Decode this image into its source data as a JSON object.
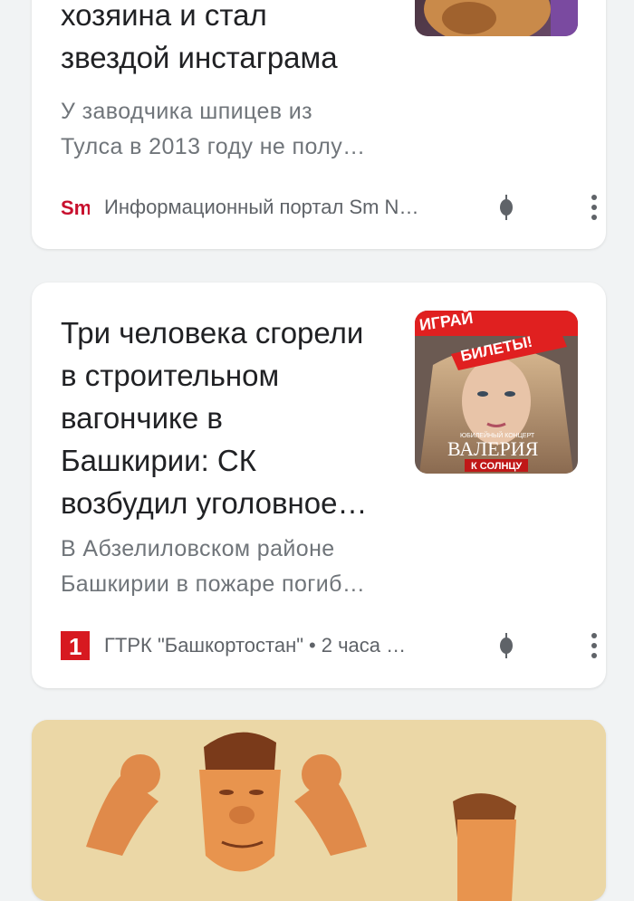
{
  "cards": [
    {
      "title_lines": [
        "хозяина и стал",
        "звездой инстаграма"
      ],
      "snippet_lines": [
        "У заводчика шпицев из",
        "Тулса в 2013 году не полу…"
      ],
      "source": {
        "logo_text": "Sm",
        "name": "Информационный портал Sm N…"
      },
      "thumbnail": "dog-photo"
    },
    {
      "title_lines": [
        "Три человека сгорели",
        "в строительном",
        "вагончике в",
        "Башкирии: СК",
        "возбудил уголовное…"
      ],
      "snippet_lines": [
        "В Абзелиловском районе",
        "Башкирии в пожаре погиб…"
      ],
      "source": {
        "logo_text": "1",
        "name": "ГТРК \"Башкортостан\"",
        "separator": "•",
        "time": "2 часа …"
      },
      "thumbnail": {
        "top_text": "ИГРАЙ",
        "banner_text": "БИЛЕТЫ!",
        "small_text": "ЮБИЛЕЙНЫЙ КОНЦЕРТ",
        "name_text": "ВАЛЕРИЯ",
        "tour_text": "К СОЛНЦУ"
      }
    },
    {
      "image": "cartoon-strong-men-illustration"
    }
  ],
  "colors": {
    "title": "#202124",
    "snippet": "#70757a",
    "source": "#5f6368",
    "sm_logo": "#c8102e",
    "one_logo": "#d71920",
    "page_bg": "#f1f3f4"
  }
}
